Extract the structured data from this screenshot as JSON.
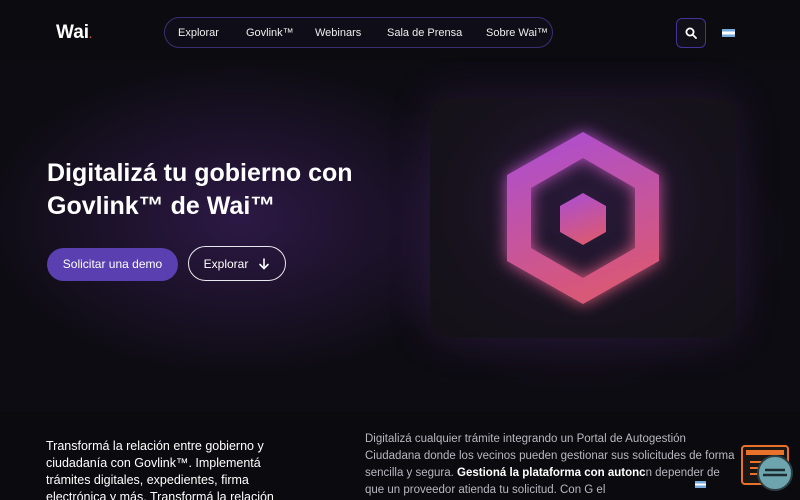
{
  "header": {
    "logo_text": "Wai",
    "logo_dot": ".",
    "nav": [
      {
        "label": "Explorar"
      },
      {
        "label": "Govlink™"
      },
      {
        "label": "Webinars"
      },
      {
        "label": "Sala de Prensa"
      },
      {
        "label": "Sobre Wai™"
      }
    ],
    "search_icon": "search-icon",
    "language_flag": "argentina-flag-icon"
  },
  "hero": {
    "title": "Digitalizá tu gobierno con Govlink™ de Wai™",
    "cta_primary": "Solicitar una demo",
    "cta_secondary": "Explorar",
    "cta_secondary_icon": "arrow-down-icon",
    "graphic": "hexagon-logo-icon"
  },
  "content": {
    "intro": "Transformá la relación entre gobierno y ciudadanía con Govlink™. Implementá trámites digitales, expedientes, firma electrónica y más. Transformá la relación",
    "body_start": "Digitalizá cualquier trámite integrando un Portal de Autogestión Ciudadana donde los vecinos pueden gestionar sus solicitudes de forma sencilla y segura. ",
    "body_bold": "Gestioná la plataforma con autonc",
    "body_end": "n depender de que un proveedor atienda tu solicitud. Con G        el"
  },
  "colors": {
    "accent": "#5a3fb0",
    "nav_border": "#3b2f74",
    "hex_gradient_top": "#b04fd0",
    "hex_gradient_bottom": "#d2557a"
  }
}
